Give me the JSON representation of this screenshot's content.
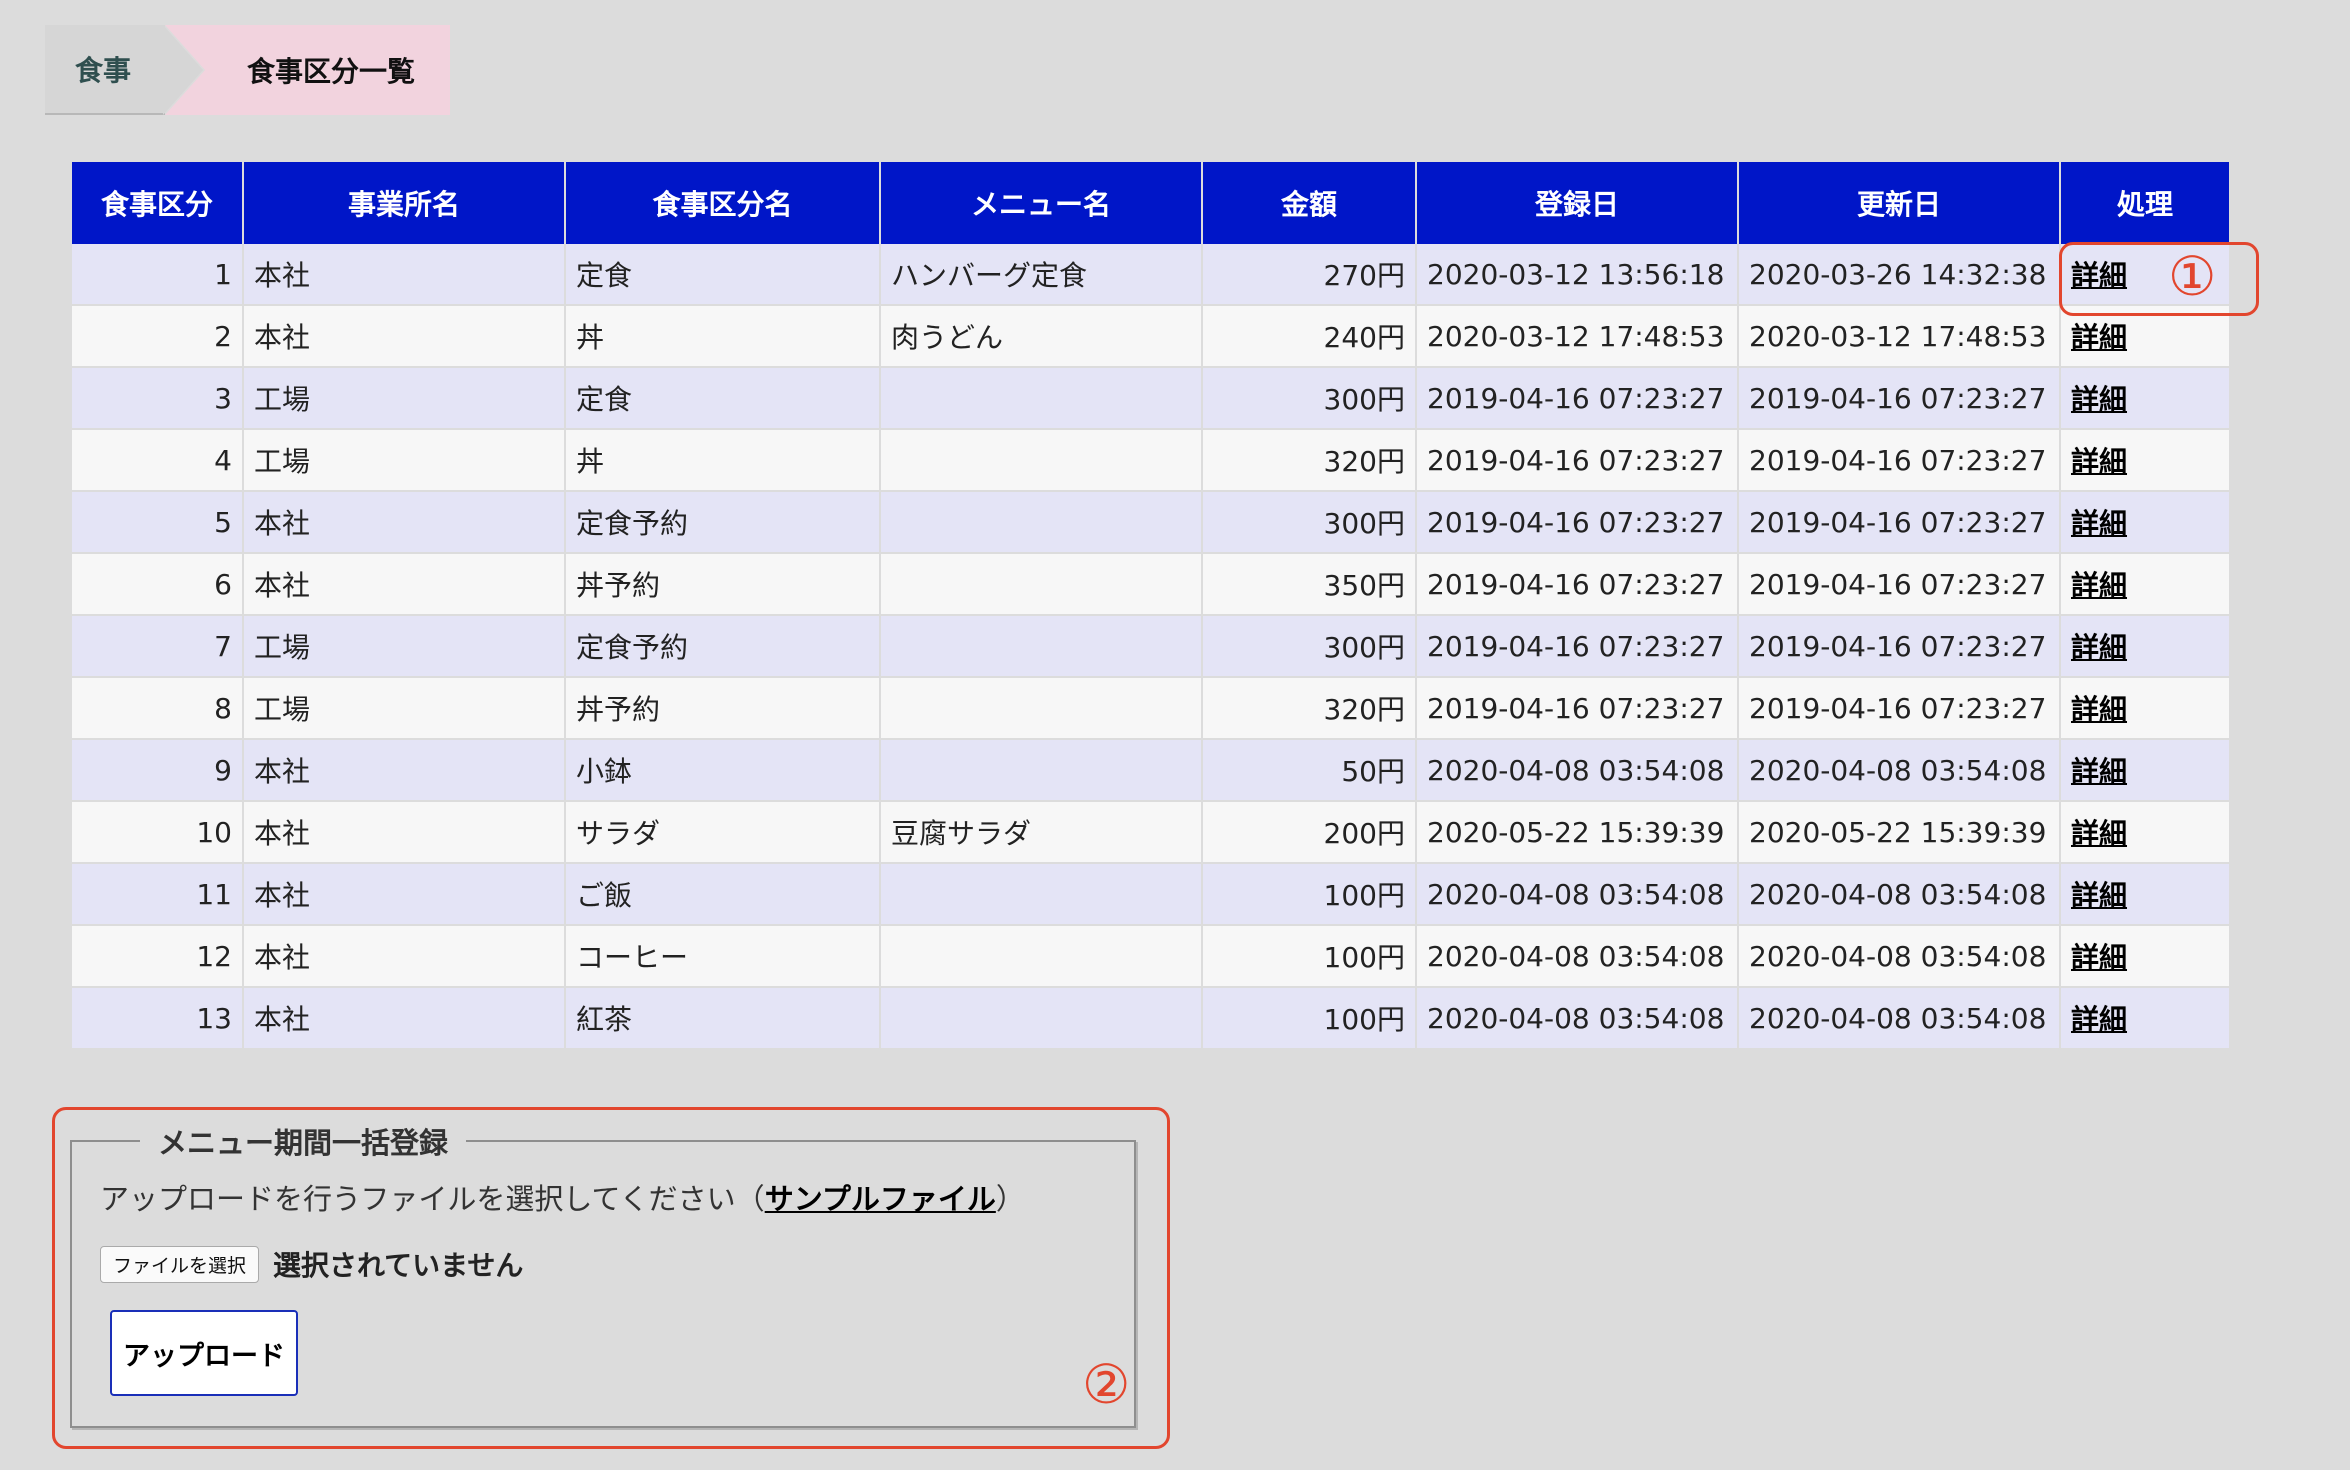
{
  "breadcrumb": {
    "home": "食事",
    "current": "食事区分一覧"
  },
  "table": {
    "headers": [
      "食事区分",
      "事業所名",
      "食事区分名",
      "メニュー名",
      "金額",
      "登録日",
      "更新日",
      "処理"
    ],
    "rows": [
      {
        "id": "1",
        "office": "本社",
        "category": "定食",
        "menu": "ハンバーグ定食",
        "price": "270円",
        "created": "2020-03-12 13:56:18",
        "updated": "2020-03-26 14:32:38",
        "action": "詳細"
      },
      {
        "id": "2",
        "office": "本社",
        "category": "丼",
        "menu": "肉うどん",
        "price": "240円",
        "created": "2020-03-12 17:48:53",
        "updated": "2020-03-12 17:48:53",
        "action": "詳細"
      },
      {
        "id": "3",
        "office": "工場",
        "category": "定食",
        "menu": "",
        "price": "300円",
        "created": "2019-04-16 07:23:27",
        "updated": "2019-04-16 07:23:27",
        "action": "詳細"
      },
      {
        "id": "4",
        "office": "工場",
        "category": "丼",
        "menu": "",
        "price": "320円",
        "created": "2019-04-16 07:23:27",
        "updated": "2019-04-16 07:23:27",
        "action": "詳細"
      },
      {
        "id": "5",
        "office": "本社",
        "category": "定食予約",
        "menu": "",
        "price": "300円",
        "created": "2019-04-16 07:23:27",
        "updated": "2019-04-16 07:23:27",
        "action": "詳細"
      },
      {
        "id": "6",
        "office": "本社",
        "category": "丼予約",
        "menu": "",
        "price": "350円",
        "created": "2019-04-16 07:23:27",
        "updated": "2019-04-16 07:23:27",
        "action": "詳細"
      },
      {
        "id": "7",
        "office": "工場",
        "category": "定食予約",
        "menu": "",
        "price": "300円",
        "created": "2019-04-16 07:23:27",
        "updated": "2019-04-16 07:23:27",
        "action": "詳細"
      },
      {
        "id": "8",
        "office": "工場",
        "category": "丼予約",
        "menu": "",
        "price": "320円",
        "created": "2019-04-16 07:23:27",
        "updated": "2019-04-16 07:23:27",
        "action": "詳細"
      },
      {
        "id": "9",
        "office": "本社",
        "category": "小鉢",
        "menu": "",
        "price": "50円",
        "created": "2020-04-08 03:54:08",
        "updated": "2020-04-08 03:54:08",
        "action": "詳細"
      },
      {
        "id": "10",
        "office": "本社",
        "category": "サラダ",
        "menu": "豆腐サラダ",
        "price": "200円",
        "created": "2020-05-22 15:39:39",
        "updated": "2020-05-22 15:39:39",
        "action": "詳細"
      },
      {
        "id": "11",
        "office": "本社",
        "category": "ご飯",
        "menu": "",
        "price": "100円",
        "created": "2020-04-08 03:54:08",
        "updated": "2020-04-08 03:54:08",
        "action": "詳細"
      },
      {
        "id": "12",
        "office": "本社",
        "category": "コーヒー",
        "menu": "",
        "price": "100円",
        "created": "2020-04-08 03:54:08",
        "updated": "2020-04-08 03:54:08",
        "action": "詳細"
      },
      {
        "id": "13",
        "office": "本社",
        "category": "紅茶",
        "menu": "",
        "price": "100円",
        "created": "2020-04-08 03:54:08",
        "updated": "2020-04-08 03:54:08",
        "action": "詳細"
      }
    ]
  },
  "upload": {
    "legend": "メニュー期間一括登録",
    "instruction_prefix": "アップロードを行うファイルを選択してください（",
    "sample_link": "サンプルファイル",
    "instruction_suffix": "）",
    "file_button": "ファイルを選択",
    "file_status": "選択されていません",
    "upload_button": "アップロード"
  },
  "annotations": {
    "first": "①",
    "second": "②"
  },
  "colors": {
    "header_bg": "#0016c8",
    "odd_row": "#e4e4f6",
    "even_row": "#f7f7f7",
    "annotation": "#e2462e",
    "breadcrumb_current": "#f2d3de"
  }
}
